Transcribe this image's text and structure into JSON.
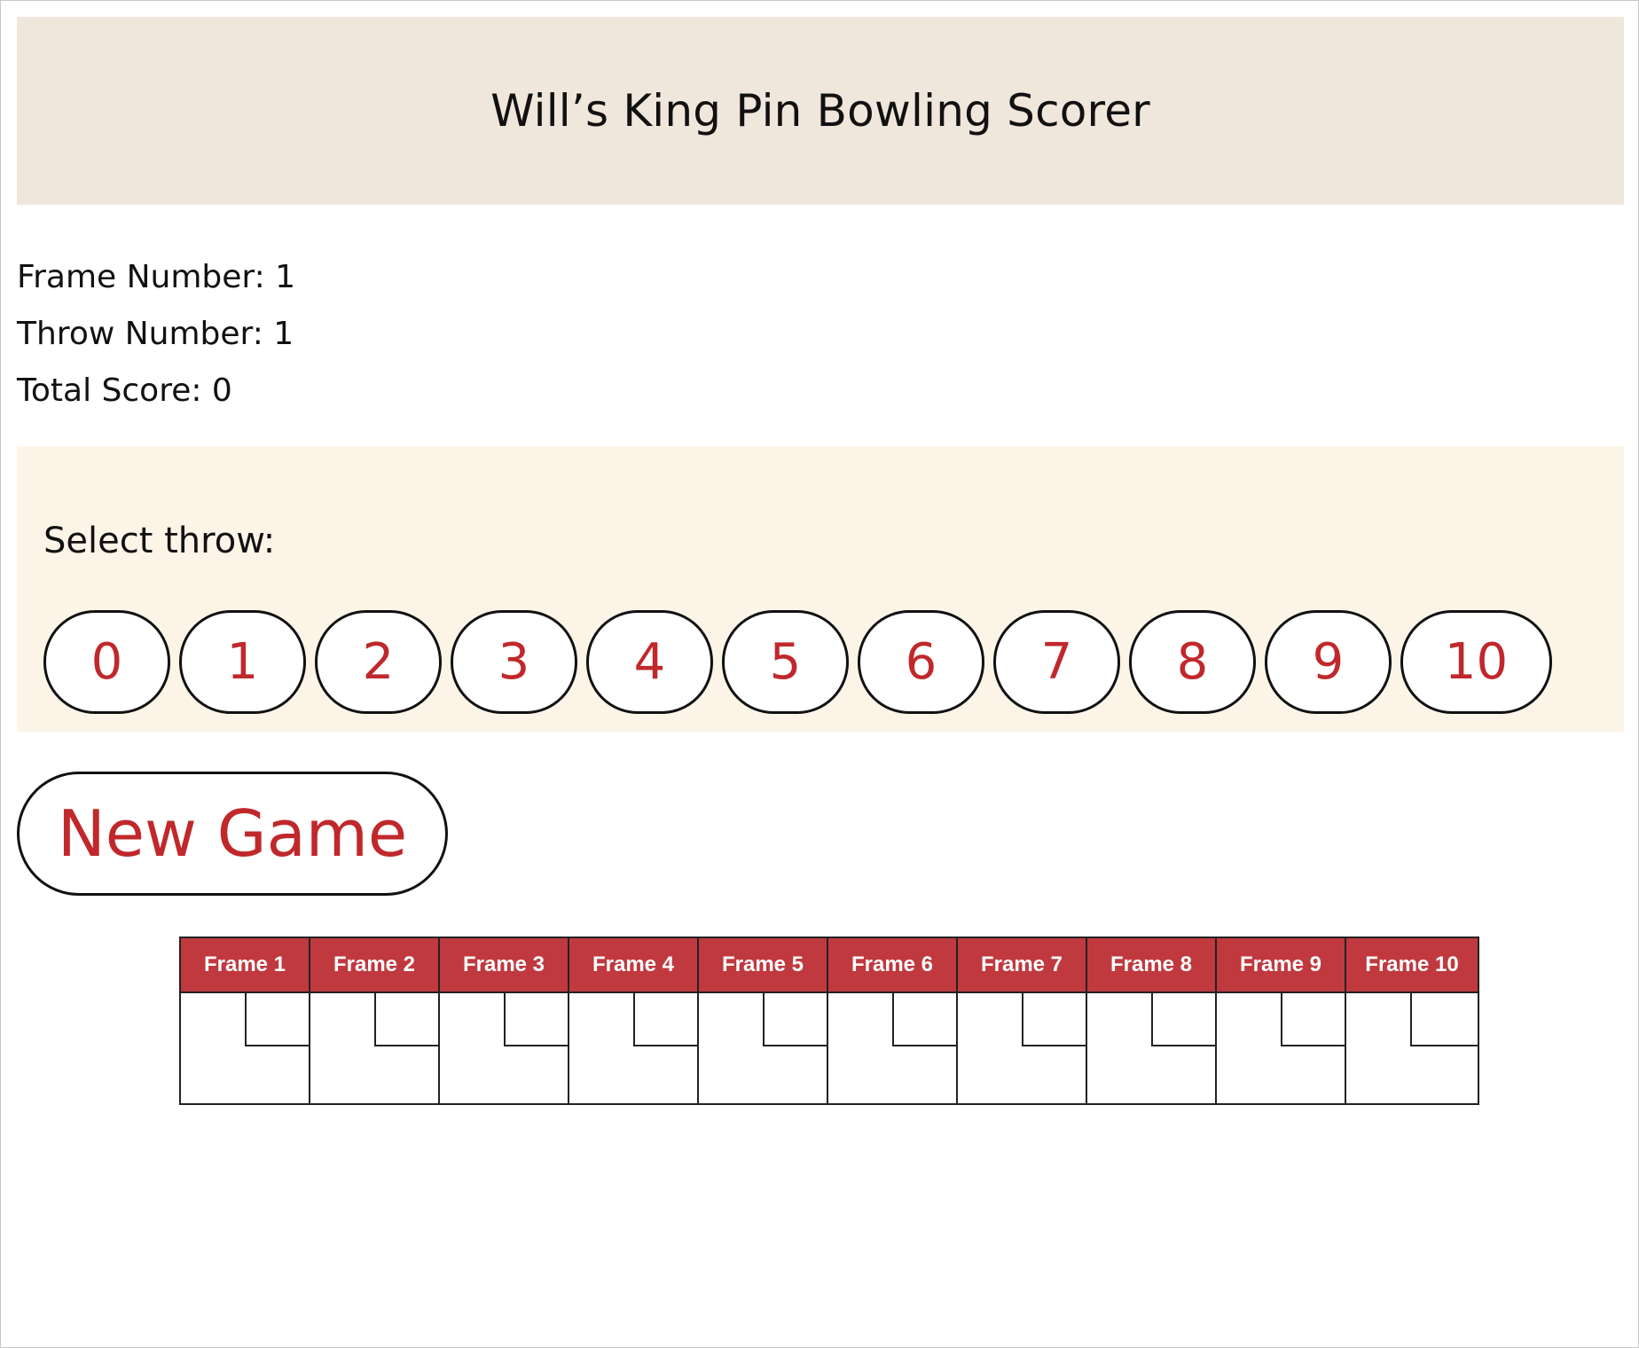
{
  "header": {
    "title": "Will’s King Pin Bowling Scorer"
  },
  "status": {
    "frame_number": "Frame Number: 1",
    "throw_number": "Throw Number: 1",
    "total_score": "Total Score: 0"
  },
  "throw_panel": {
    "label": "Select throw:",
    "buttons": [
      "0",
      "1",
      "2",
      "3",
      "4",
      "5",
      "6",
      "7",
      "8",
      "9",
      "10"
    ]
  },
  "new_game": {
    "label": "New Game"
  },
  "scorecard": {
    "frames": [
      {
        "label": "Frame 1",
        "throw": "",
        "score": ""
      },
      {
        "label": "Frame 2",
        "throw": "",
        "score": ""
      },
      {
        "label": "Frame 3",
        "throw": "",
        "score": ""
      },
      {
        "label": "Frame 4",
        "throw": "",
        "score": ""
      },
      {
        "label": "Frame 5",
        "throw": "",
        "score": ""
      },
      {
        "label": "Frame 6",
        "throw": "",
        "score": ""
      },
      {
        "label": "Frame 7",
        "throw": "",
        "score": ""
      },
      {
        "label": "Frame 8",
        "throw": "",
        "score": ""
      },
      {
        "label": "Frame 9",
        "throw": "",
        "score": ""
      },
      {
        "label": "Frame 10",
        "throw": "",
        "score": ""
      }
    ]
  },
  "colors": {
    "header_bg": "#f0e7dc",
    "panel_bg": "#fdf4e8",
    "accent_red": "#c0282b",
    "frame_header_bg": "#c0393f"
  }
}
